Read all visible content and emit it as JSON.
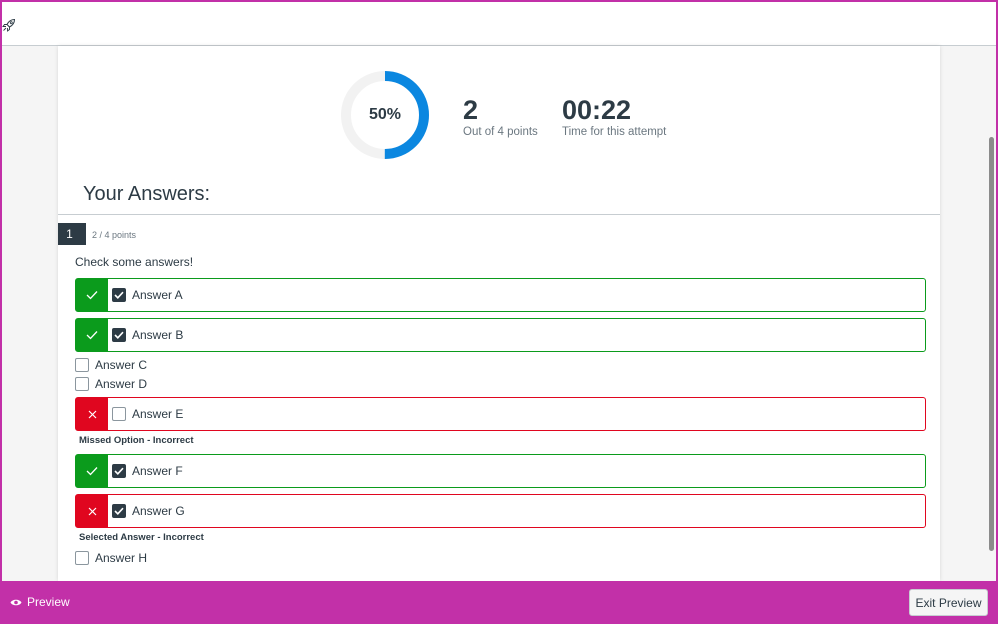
{
  "header": {
    "icon": "rocket-icon"
  },
  "score": {
    "percent_label": "50%",
    "percent_value": 50,
    "ring_color": "#0b87e0",
    "track_color": "#f2f2f2",
    "points_value": "2",
    "points_caption": "Out of 4 points",
    "time_value": "00:22",
    "time_caption": "Time for this attempt"
  },
  "answers_heading": "Your Answers:",
  "question": {
    "number": "1",
    "points": "2 / 4 points",
    "text": "Check some answers!",
    "options": [
      {
        "label": "Answer A",
        "checked": true,
        "status": "correct"
      },
      {
        "label": "Answer B",
        "checked": true,
        "status": "correct"
      },
      {
        "label": "Answer C",
        "checked": false,
        "status": "none"
      },
      {
        "label": "Answer D",
        "checked": false,
        "status": "none"
      },
      {
        "label": "Answer E",
        "checked": false,
        "status": "incorrect",
        "feedback": "Missed Option - Incorrect"
      },
      {
        "label": "Answer F",
        "checked": true,
        "status": "correct"
      },
      {
        "label": "Answer G",
        "checked": true,
        "status": "incorrect",
        "feedback": "Selected Answer - Incorrect"
      },
      {
        "label": "Answer H",
        "checked": false,
        "status": "none"
      }
    ]
  },
  "footer": {
    "preview_label": "Preview",
    "exit_label": "Exit Preview"
  },
  "colors": {
    "correct": "#0b9b1c",
    "incorrect": "#e0061f",
    "preview_bar": "#c230a8"
  }
}
